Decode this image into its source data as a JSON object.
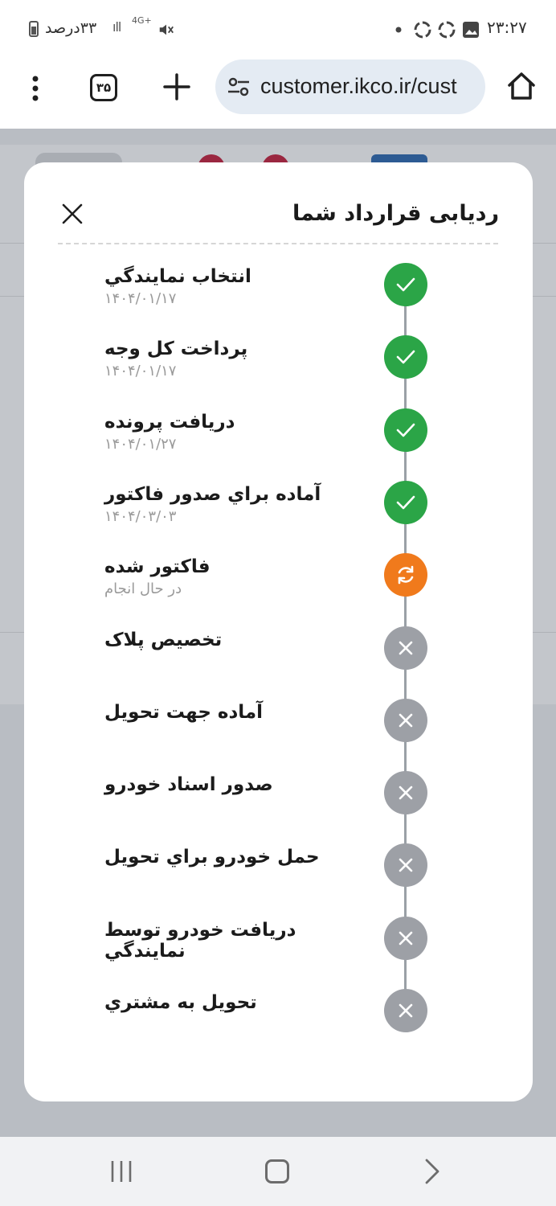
{
  "status_bar": {
    "time": "۲۳:۲۷",
    "battery_text": "۳۳درصد",
    "network": "4G+"
  },
  "browser": {
    "url": "customer.ikco.ir/cust",
    "tab_count": "۳۵"
  },
  "modal": {
    "title": "ردیابی قرارداد شما"
  },
  "steps": [
    {
      "label": "انتخاب نمايندگي",
      "sub": "۱۴۰۴/۰۱/۱۷",
      "status": "done"
    },
    {
      "label": "پرداخت کل وجه",
      "sub": "۱۴۰۴/۰۱/۱۷",
      "status": "done"
    },
    {
      "label": "دریافت پرونده",
      "sub": "۱۴۰۴/۰۱/۲۷",
      "status": "done"
    },
    {
      "label": "آماده براي صدور فاکتور",
      "sub": "۱۴۰۴/۰۳/۰۳",
      "status": "done"
    },
    {
      "label": "فاکتور شده",
      "sub": "در حال انجام",
      "status": "in-progress"
    },
    {
      "label": "تخصیص پلاک",
      "sub": "",
      "status": "pending"
    },
    {
      "label": "آماده جهت تحويل",
      "sub": "",
      "status": "pending"
    },
    {
      "label": "صدور اسناد خودرو",
      "sub": "",
      "status": "pending"
    },
    {
      "label": "حمل خودرو براي تحويل",
      "sub": "",
      "status": "pending"
    },
    {
      "label": "دريافت خودرو توسط نمايندگي",
      "sub": "",
      "status": "pending"
    },
    {
      "label": "تحويل به مشتري",
      "sub": "",
      "status": "pending"
    }
  ],
  "colors": {
    "done": "#2ba547",
    "in_progress": "#f07a1c",
    "pending": "#9da0a6"
  },
  "icons": {
    "done": "check-icon",
    "in_progress": "refresh-icon",
    "pending": "x-icon"
  }
}
